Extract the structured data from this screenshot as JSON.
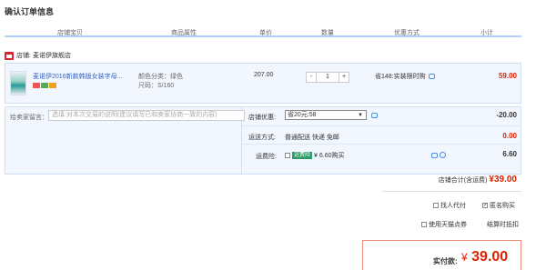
{
  "page_title": "确认订单信息",
  "columns": [
    "店铺宝贝",
    "商品属性",
    "单价",
    "数量",
    "优惠方式",
    "小计"
  ],
  "shop": {
    "label": "店铺:",
    "name": "麦诺伊旗舰店"
  },
  "item": {
    "title": "麦诺伊2016新款韩版女装字母...",
    "attr_color": "颜色分类：绿色",
    "attr_size": "尺码：S/160",
    "price": "207.00",
    "quantity": "1",
    "qty_minus": "-",
    "qty_plus": "+",
    "promo": "省148:实装限时购",
    "subtotal": "59.00"
  },
  "message": {
    "label": "给卖家留言：",
    "placeholder": "选填:对本次交易的说明(建议填写已和卖家协商一致的内容)"
  },
  "shop_discount": {
    "label": "店铺优惠:",
    "selected": "省20元:58",
    "amount": "-20.00"
  },
  "shipping": {
    "label": "运送方式:",
    "value": "普通配送 快递 免邮",
    "amount": "0.00"
  },
  "insurance": {
    "label": "运费险:",
    "tag": "运费险",
    "value": "¥ 6.60购买",
    "amount": "6.60"
  },
  "shop_total": {
    "label": "店铺合计(含运费)",
    "amount": "¥39.00"
  },
  "options": {
    "proxy_pay": "找人代付",
    "anonymous": "匿名购买",
    "tmall_points": "使用天猫点券",
    "installment": "结算时抵扣"
  },
  "payment": {
    "label": "实付款:",
    "yen": "¥",
    "amount": "39.00"
  },
  "colors": {
    "accent_red": "#dd2200",
    "link_blue": "#3366cc",
    "header_border": "#b2d1ff"
  }
}
